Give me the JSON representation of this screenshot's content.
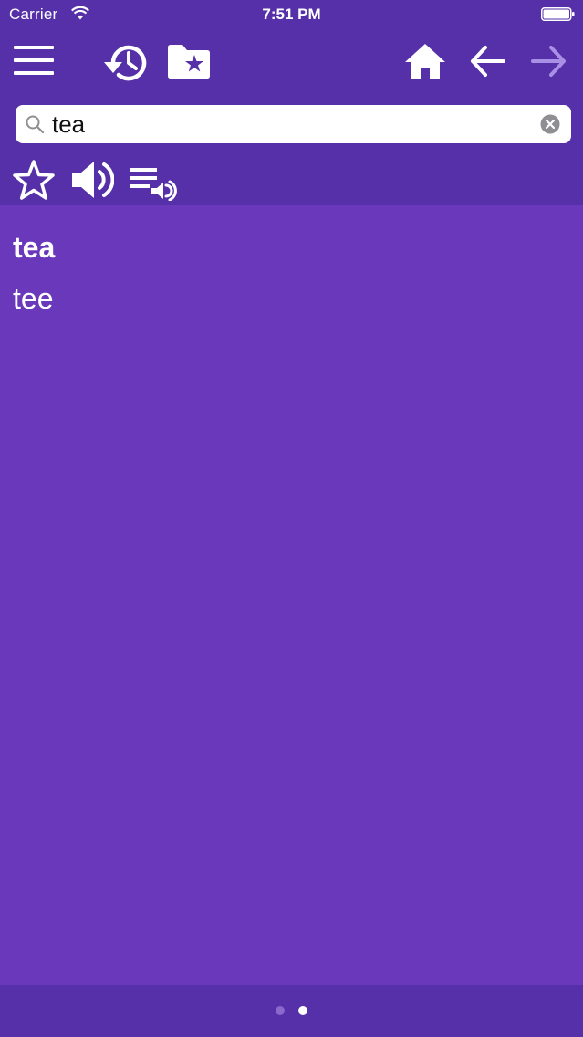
{
  "status_bar": {
    "carrier": "Carrier",
    "time": "7:51 PM"
  },
  "toolbar": {
    "icons": [
      "menu-icon",
      "history-icon",
      "favorites-folder-icon",
      "home-icon",
      "back-arrow-icon",
      "forward-arrow-icon"
    ]
  },
  "search": {
    "value": "tea",
    "placeholder": ""
  },
  "actions": {
    "icons": [
      "star-outline-icon",
      "speaker-icon",
      "playlist-audio-icon"
    ]
  },
  "results": [
    {
      "text": "tea"
    },
    {
      "text": "tee"
    }
  ],
  "pager": {
    "page_count": 2,
    "active_page": 2
  },
  "colors": {
    "header_bg": "#5530a8",
    "content_bg": "#6a38bb",
    "forward_disabled": "#a98fe6"
  }
}
